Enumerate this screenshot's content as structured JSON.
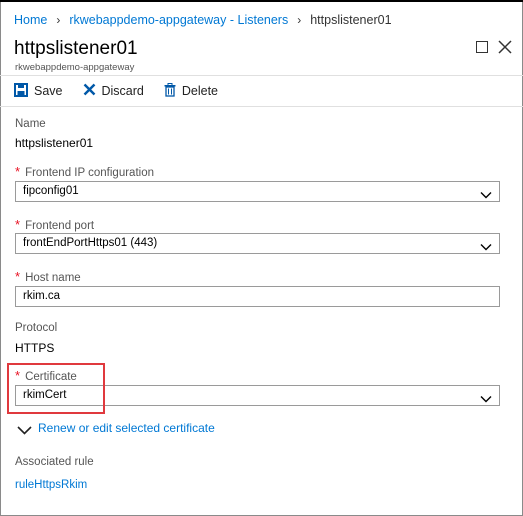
{
  "breadcrumb": {
    "items": [
      "Home",
      "rkwebappdemo-appgateway - Listeners",
      "httpslistener01"
    ]
  },
  "header": {
    "title": "httpslistener01",
    "subtitle": "rkwebappdemo-appgateway"
  },
  "toolbar": {
    "save_label": "Save",
    "discard_label": "Discard",
    "delete_label": "Delete"
  },
  "form": {
    "name": {
      "label": "Name",
      "value": "httpslistener01"
    },
    "frontend_ip": {
      "label": "Frontend IP configuration",
      "value": "fipconfig01"
    },
    "frontend_port": {
      "label": "Frontend port",
      "value": "frontEndPortHttps01 (443)"
    },
    "host_name": {
      "label": "Host name",
      "value": "rkim.ca"
    },
    "protocol": {
      "label": "Protocol",
      "value": "HTTPS"
    },
    "certificate": {
      "label": "Certificate",
      "value": "rkimCert"
    },
    "renew_link": "Renew or edit selected certificate",
    "associated_rule": {
      "label": "Associated rule",
      "value": "ruleHttpsRkim"
    },
    "required_mark": "*"
  },
  "colors": {
    "accent": "#0078d4",
    "required": "#e81123",
    "highlight": "#e0393e"
  },
  "icons": {
    "save": "save-icon",
    "discard": "discard-x-icon",
    "delete": "trash-icon",
    "maximize": "maximize-icon",
    "close": "close-icon",
    "dropdown": "chevron-down-icon",
    "breadcrumb_separator": "chevron-right-icon"
  }
}
